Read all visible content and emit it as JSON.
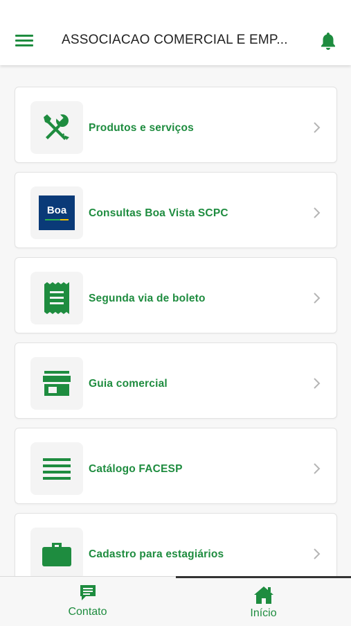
{
  "header": {
    "title": "ASSOCIACAO COMERCIAL E EMP...",
    "menu_icon": "hamburger-menu-icon",
    "bell_icon": "bell-icon"
  },
  "colors": {
    "accent": "#1e8c3f",
    "boa_blue": "#0a3a78"
  },
  "items": [
    {
      "label": "Produtos e serviços",
      "icon": "tools-icon"
    },
    {
      "label": "Consultas Boa Vista SCPC",
      "icon": "boa-vista-logo",
      "logo_text": "Boa"
    },
    {
      "label": "Segunda via de boleto",
      "icon": "receipt-icon"
    },
    {
      "label": "Guia comercial",
      "icon": "store-icon"
    },
    {
      "label": "Catálogo FACESP",
      "icon": "list-lines-icon"
    },
    {
      "label": "Cadastro para estagiários",
      "icon": "briefcase-icon"
    }
  ],
  "tabs": [
    {
      "label": "Contato",
      "icon": "chat-icon"
    },
    {
      "label": "Início",
      "icon": "home-icon"
    }
  ]
}
